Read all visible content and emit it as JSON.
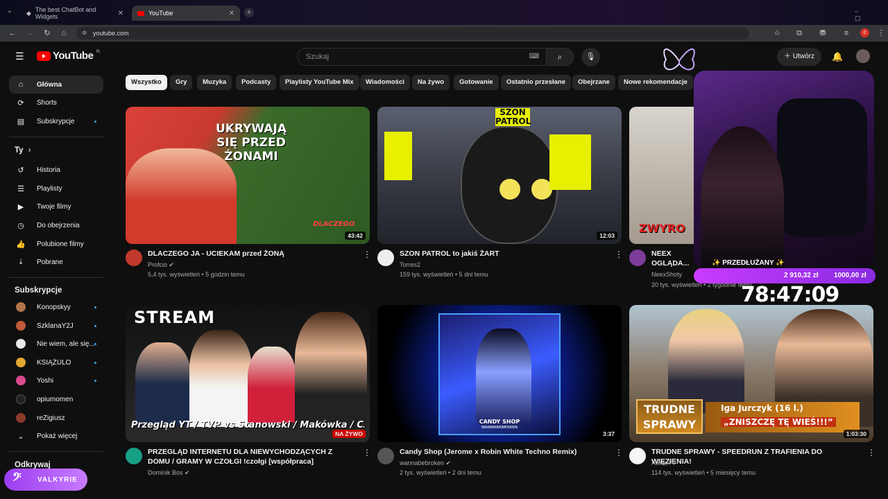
{
  "browser": {
    "tabs": [
      {
        "title": "The best ChatBot and Widgets",
        "active": false
      },
      {
        "title": "YouTube",
        "active": true
      }
    ],
    "url": "youtube.com",
    "badge_count": "0"
  },
  "header": {
    "logo_text": "YouTube",
    "logo_region": "PL",
    "search_placeholder": "Szukaj",
    "create_label": "Utwórz"
  },
  "sidebar": {
    "main": [
      {
        "label": "Główna",
        "icon": "home-icon",
        "active": true
      },
      {
        "label": "Shorts",
        "icon": "shorts-icon",
        "active": false
      },
      {
        "label": "Subskrypcje",
        "icon": "subscriptions-icon",
        "active": false
      }
    ],
    "you_heading": "Ty",
    "you": [
      {
        "label": "Historia",
        "icon": "history-icon"
      },
      {
        "label": "Playlisty",
        "icon": "playlists-icon"
      },
      {
        "label": "Twoje filmy",
        "icon": "your-videos-icon"
      },
      {
        "label": "Do obejrzenia",
        "icon": "watch-later-icon"
      },
      {
        "label": "Polubione filmy",
        "icon": "liked-icon"
      },
      {
        "label": "Pobrane",
        "icon": "download-icon"
      }
    ],
    "subs_heading": "Subskrypcje",
    "subs": [
      {
        "label": "Konopskyy",
        "color": "#b0764a"
      },
      {
        "label": "SzklanaY2J",
        "color": "#c05a3a"
      },
      {
        "label": "Nie wiem, ale się...",
        "color": "#e8e8e8"
      },
      {
        "label": "KSIĄŻULO",
        "color": "#e3a72f"
      },
      {
        "label": "Yoshi",
        "color": "#d84a8c"
      },
      {
        "label": "opiumomen",
        "color": "#222222"
      },
      {
        "label": "reZigiusz",
        "color": "#8a3a2a"
      }
    ],
    "show_more": "Pokaż więcej",
    "explore_heading": "Odkrywaj"
  },
  "chips": [
    "Wszystko",
    "Gry",
    "Muzyka",
    "Podcasty",
    "Playlisty YouTube Mix",
    "Wiadomości",
    "Na żywo",
    "Gotowanie",
    "Ostatnio przesłane",
    "Obejrzane",
    "Nowe rekomendacje"
  ],
  "videos": [
    {
      "title": "DLACZEGO JA - UCIEKAM przed ŻONĄ",
      "channel": "Profcio",
      "verified": true,
      "meta": "5,4 tys. wyświetleń • 5 godzin temu",
      "duration": "43:42",
      "thumb_text": "UKRYWAJĄ SIĘ PRZED ŻONAMI",
      "thumb_tag": "DLACZEGO",
      "avatar_color": "#c0392b"
    },
    {
      "title": "SZON PATROL to jakiś ŻART",
      "channel": "Torres2",
      "verified": false,
      "meta": "159 tys. wyświetleń • 5 dni temu",
      "duration": "12:03",
      "thumb_text": "SZON PATROL",
      "avatar_color": "#eeeeee"
    },
    {
      "title": "NEEX OGLĄDA... HISTORII XD!",
      "channel": "NeexShoty",
      "verified": false,
      "meta": "20 tys. wyświetleń • 2 tygodnie temu",
      "duration": "",
      "thumb_text": "ZWYRO",
      "avatar_color": "#7d3c98"
    },
    {
      "title": "PRZEGLĄD INTERNETU DLA NIEWYCHODZĄCYCH Z DOMU / GRAMY W CZOŁGI !czołgi [współpraca]",
      "channel": "Dominik Bos",
      "verified": true,
      "meta": "",
      "duration": "",
      "live_label": "NA ŻYWO",
      "thumb_text": "STREAM",
      "thumb_caption": "Przegląd YT / TVP vs Stanowski / Makówka / Czołgi",
      "avatar_color": "#16a085"
    },
    {
      "title": "Candy Shop (Jerome x Robin White Techno Remix)",
      "channel": "wannabebroken",
      "verified": true,
      "meta": "2 tys. wyświetleń • 2 dni temu",
      "duration": "3:37",
      "thumb_text": "CANDY SHOP",
      "thumb_sub": "WANNABEBROKEN",
      "avatar_color": "#555555"
    },
    {
      "title": "TRUDNE SPRAWY - SPEEDRUN Z TRAFIENIA DO WIĘZIENIA!",
      "channel": "AwizoTV",
      "verified": false,
      "meta": "114 tys. wyświetleń • 5 miesięcy temu",
      "duration": "1:03:30",
      "thumb_text": "TRUDNE SPRAWY",
      "thumb_name": "Iga Jurczyk (16 l.)",
      "thumb_quote": "„ZNISZCZĘ TĘ WIEŚ!!!”",
      "avatar_color": "#f5f5f5"
    }
  ],
  "overlay": {
    "sub_label": "✨ PRZEDŁUŻANY ✨",
    "amount_current": "2 910,32 zł",
    "amount_goal": "1000,00 zł",
    "timer": "78:47:09",
    "brand": "VALKYRIE"
  }
}
